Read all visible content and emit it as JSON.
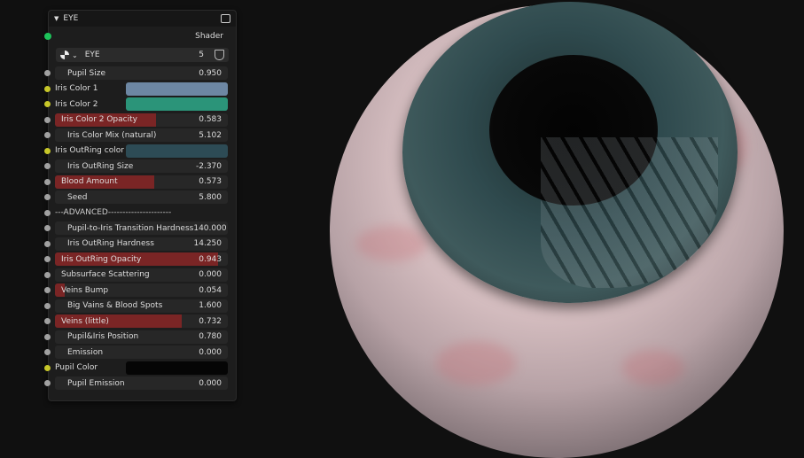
{
  "node": {
    "title": "EYE",
    "output": "Shader",
    "group": {
      "name": "EYE",
      "users": "5"
    }
  },
  "rows": [
    {
      "type": "value",
      "label": "Pupil Size",
      "value": "0.950"
    },
    {
      "type": "color",
      "label": "Iris Color 1",
      "color": "#6d87a3"
    },
    {
      "type": "color",
      "label": "Iris Color 2",
      "color": "#2b9479"
    },
    {
      "type": "factor",
      "label": "Iris Color 2 Opacity",
      "value": "0.583",
      "fraction": 0.583
    },
    {
      "type": "value",
      "label": "Iris Color Mix (natural)",
      "value": "5.102"
    },
    {
      "type": "color",
      "label": "Iris OutRing color",
      "color": "#2d4b55"
    },
    {
      "type": "value",
      "label": "Iris OutRing Size",
      "value": "-2.370"
    },
    {
      "type": "factor",
      "label": "Blood Amount",
      "value": "0.573",
      "fraction": 0.573
    },
    {
      "type": "value",
      "label": "Seed",
      "value": "5.800"
    },
    {
      "type": "separator",
      "label": "---ADVANCED----------------------"
    },
    {
      "type": "value",
      "label": "Pupil-to-Iris Transition Hardness",
      "value": "140.000"
    },
    {
      "type": "value",
      "label": "Iris OutRing Hardness",
      "value": "14.250"
    },
    {
      "type": "factor",
      "label": "Iris OutRing Opacity",
      "value": "0.943",
      "fraction": 0.943
    },
    {
      "type": "factor",
      "label": "Subsurface Scattering",
      "value": "0.000",
      "fraction": 0
    },
    {
      "type": "factor",
      "label": "Veins Bump",
      "value": "0.054",
      "fraction": 0.054
    },
    {
      "type": "value",
      "label": "Big Vains & Blood Spots",
      "value": "1.600"
    },
    {
      "type": "factor",
      "label": "Veins (little)",
      "value": "0.732",
      "fraction": 0.732
    },
    {
      "type": "value",
      "label": "Pupil&Iris Position",
      "value": "0.780"
    },
    {
      "type": "value",
      "label": "Emission",
      "value": "0.000"
    },
    {
      "type": "color",
      "label": "Pupil Color",
      "color": "#050505"
    },
    {
      "type": "value",
      "label": "Pupil Emission",
      "value": "0.000"
    }
  ]
}
